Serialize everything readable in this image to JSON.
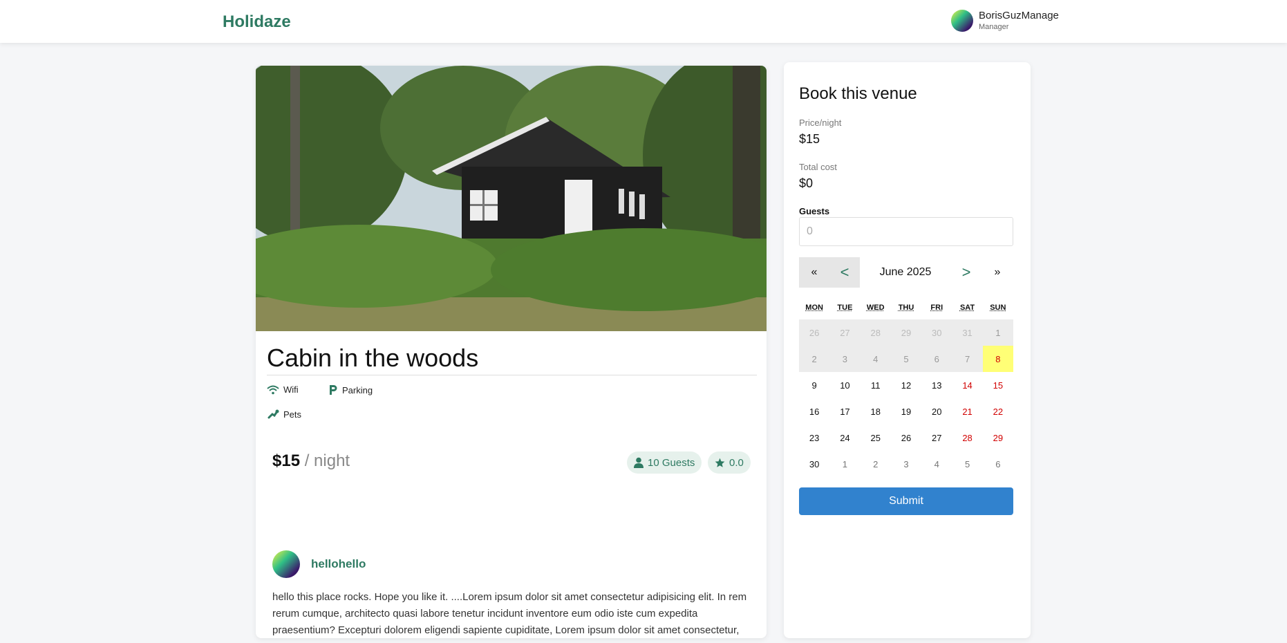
{
  "header": {
    "logo": "Holidaze",
    "user_name": "BorisGuzManage",
    "user_role": "Manager"
  },
  "venue": {
    "title": "Cabin in the woods",
    "amenities": [
      {
        "label": "Wifi",
        "icon": "wifi-icon"
      },
      {
        "label": "Parking",
        "icon": "parking-icon"
      },
      {
        "label": "Pets",
        "icon": "paw-icon"
      }
    ],
    "price": "$15",
    "price_unit": "/ night",
    "guests_badge": "10 Guests",
    "rating_badge": "0.0",
    "owner_name": "hellohello",
    "description": "hello this place rocks. Hope you like it. ....Lorem ipsum dolor sit amet consectetur adipisicing elit. In rem rerum cumque, architecto quasi labore tenetur incidunt inventore eum odio iste cum expedita praesentium? Excepturi dolorem eligendi sapiente cupiditate, Lorem ipsum dolor sit amet consectetur, adipisicing elit. Inventore veniam totam dolores sed consectetur provident similique cum! Quos dicta, omnis vero voluptate veritatis veniam illo iure, perferendis dolores consectetur ad."
  },
  "booking": {
    "title": "Book this venue",
    "price_label": "Price/night",
    "price_value": "$15",
    "total_label": "Total cost",
    "total_value": "$0",
    "guests_label": "Guests",
    "guests_placeholder": "0",
    "calendar": {
      "prev_year": "«",
      "prev_month": "<",
      "month_label": "June 2025",
      "next_month": ">",
      "next_year": "»",
      "weekdays": [
        "MON",
        "TUE",
        "WED",
        "THU",
        "FRI",
        "SAT",
        "SUN"
      ],
      "weeks": [
        [
          "26",
          "27",
          "28",
          "29",
          "30",
          "31",
          "1"
        ],
        [
          "2",
          "3",
          "4",
          "5",
          "6",
          "7",
          "8"
        ],
        [
          "9",
          "10",
          "11",
          "12",
          "13",
          "14",
          "15"
        ],
        [
          "16",
          "17",
          "18",
          "19",
          "20",
          "21",
          "22"
        ],
        [
          "23",
          "24",
          "25",
          "26",
          "27",
          "28",
          "29"
        ],
        [
          "30",
          "1",
          "2",
          "3",
          "4",
          "5",
          "6"
        ]
      ],
      "today": "8"
    },
    "submit_label": "Submit"
  },
  "colors": {
    "brand": "#2e7a62",
    "submit": "#3182ce",
    "weekend": "#d10000",
    "today_highlight": "#ffff76"
  }
}
